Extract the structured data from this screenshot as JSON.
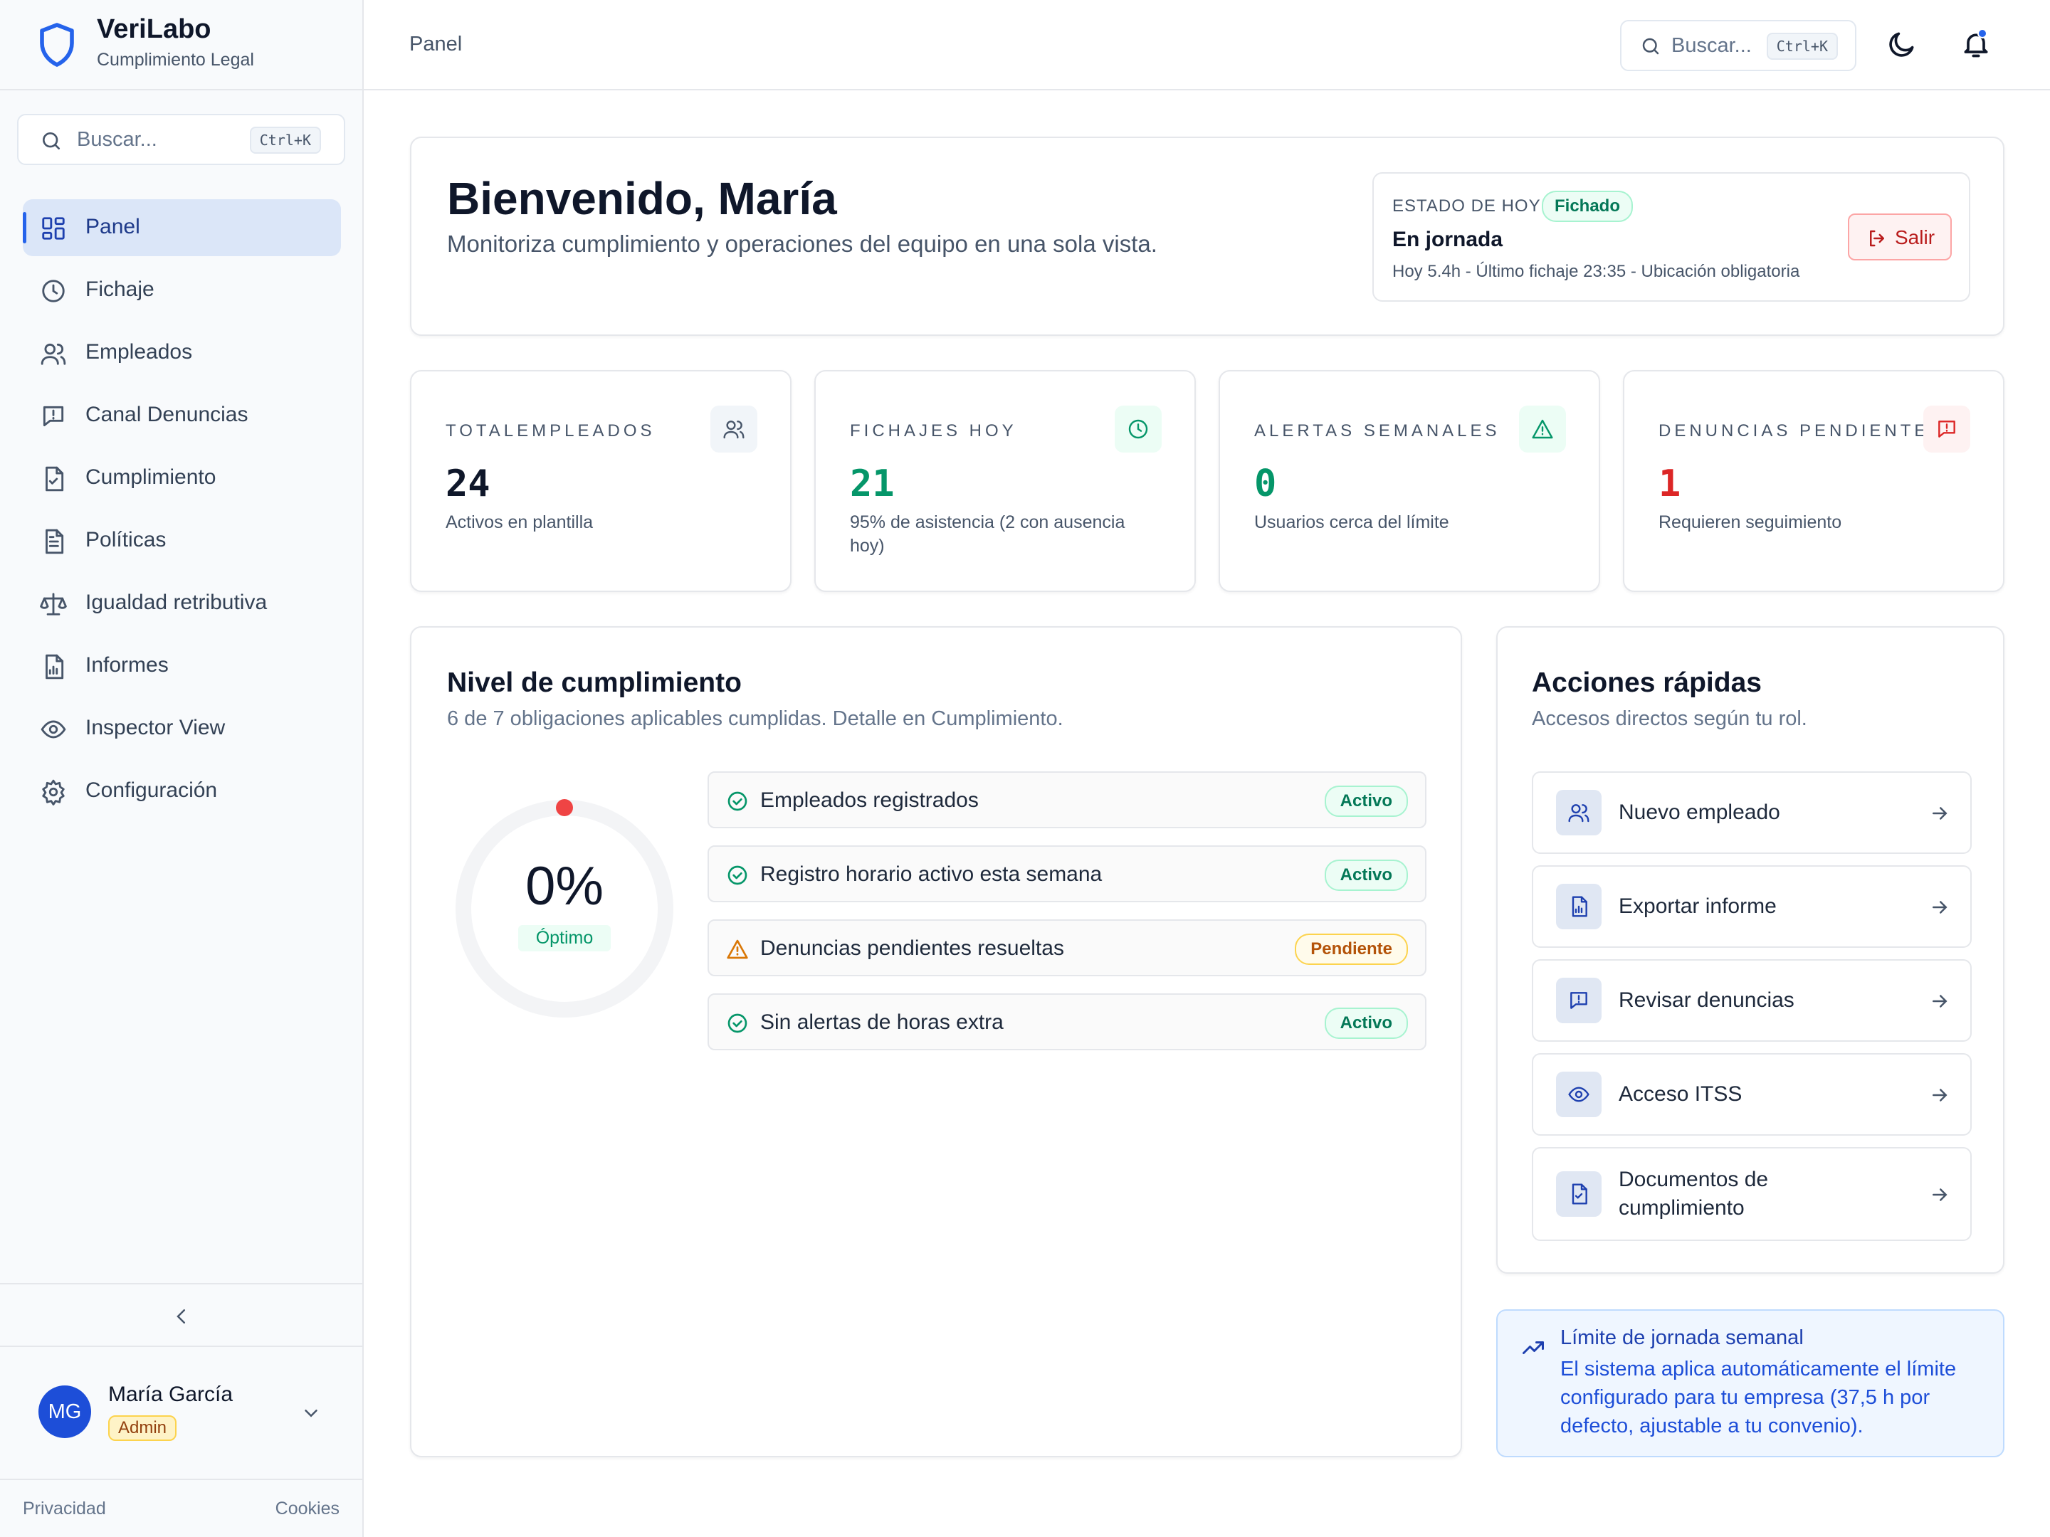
{
  "brand": {
    "name": "VeriLabo",
    "subtitle": "Cumplimiento Legal"
  },
  "sidebar": {
    "search_placeholder": "Buscar...",
    "search_shortcut": "Ctrl+K",
    "items": [
      {
        "label": "Panel",
        "icon": "dashboard-icon",
        "active": true
      },
      {
        "label": "Fichaje",
        "icon": "clock-icon"
      },
      {
        "label": "Empleados",
        "icon": "users-icon"
      },
      {
        "label": "Canal Denuncias",
        "icon": "message-alert-icon"
      },
      {
        "label": "Cumplimiento",
        "icon": "file-check-icon"
      },
      {
        "label": "Políticas",
        "icon": "document-icon"
      },
      {
        "label": "Igualdad retributiva",
        "icon": "scale-icon"
      },
      {
        "label": "Informes",
        "icon": "report-icon"
      },
      {
        "label": "Inspector View",
        "icon": "eye-icon"
      },
      {
        "label": "Configuración",
        "icon": "gear-icon"
      }
    ],
    "user": {
      "initials": "MG",
      "name": "María García",
      "role": "Admin"
    },
    "footer": {
      "privacy": "Privacidad",
      "cookies": "Cookies"
    }
  },
  "header": {
    "breadcrumb": "Panel",
    "search_placeholder": "Buscar...",
    "search_shortcut": "Ctrl+K"
  },
  "welcome": {
    "title": "Bienvenido, María",
    "subtitle": "Monitoriza cumplimiento y operaciones del equipo en una sola vista.",
    "status": {
      "label": "ESTADO DE HOY",
      "badge": "Fichado",
      "state": "En jornada",
      "detail": "Hoy 5.4h - Último fichaje 23:35 - Ubicación obligatoria",
      "exit_label": "Salir"
    }
  },
  "stats": [
    {
      "label": "TOTALEMPLEADOS",
      "value": "24",
      "desc": "Activos en plantilla",
      "icon": "users-icon",
      "color": "#0f172a",
      "icon_bg": "#f1f5f9",
      "icon_color": "#475569"
    },
    {
      "label": "FICHAJES HOY",
      "value": "21",
      "desc": "95% de asistencia (2 con ausencia hoy)",
      "icon": "clock-icon",
      "color": "#059669",
      "icon_bg": "#ecfdf5",
      "icon_color": "#059669"
    },
    {
      "label": "ALERTAS SEMANALES",
      "value": "0",
      "desc": "Usuarios cerca del límite",
      "icon": "warning-icon",
      "color": "#059669",
      "icon_bg": "#ecfdf5",
      "icon_color": "#059669"
    },
    {
      "label": "DENUNCIAS PENDIENTES",
      "value": "1",
      "desc": "Requieren seguimiento",
      "icon": "message-alert-icon",
      "color": "#dc2626",
      "icon_bg": "#fef2f2",
      "icon_color": "#dc2626"
    }
  ],
  "compliance": {
    "title": "Nivel de cumplimiento",
    "subtitle": "6 de 7 obligaciones aplicables cumplidas. Detalle en Cumplimiento.",
    "gauge_value": "0%",
    "gauge_label": "Óptimo",
    "gauge_fraction": 0,
    "items": [
      {
        "label": "Empleados registrados",
        "status": "Activo",
        "kind": "ok"
      },
      {
        "label": "Registro horario activo esta semana",
        "status": "Activo",
        "kind": "ok"
      },
      {
        "label": "Denuncias pendientes resueltas",
        "status": "Pendiente",
        "kind": "pend"
      },
      {
        "label": "Sin alertas de horas extra",
        "status": "Activo",
        "kind": "ok"
      }
    ]
  },
  "quick_actions": {
    "title": "Acciones rápidas",
    "subtitle": "Accesos directos según tu rol.",
    "items": [
      {
        "label": "Nuevo empleado",
        "icon": "users-icon"
      },
      {
        "label": "Exportar informe",
        "icon": "report-icon"
      },
      {
        "label": "Revisar denuncias",
        "icon": "message-alert-icon"
      },
      {
        "label": "Acceso ITSS",
        "icon": "eye-icon"
      },
      {
        "label": "Documentos de cumplimiento",
        "icon": "file-check-icon"
      }
    ]
  },
  "notice": {
    "title": "Límite de jornada semanal",
    "body": "El sistema aplica automáticamente el límite configurado para tu empresa (37,5 h por defecto, ajustable a tu convenio)."
  }
}
